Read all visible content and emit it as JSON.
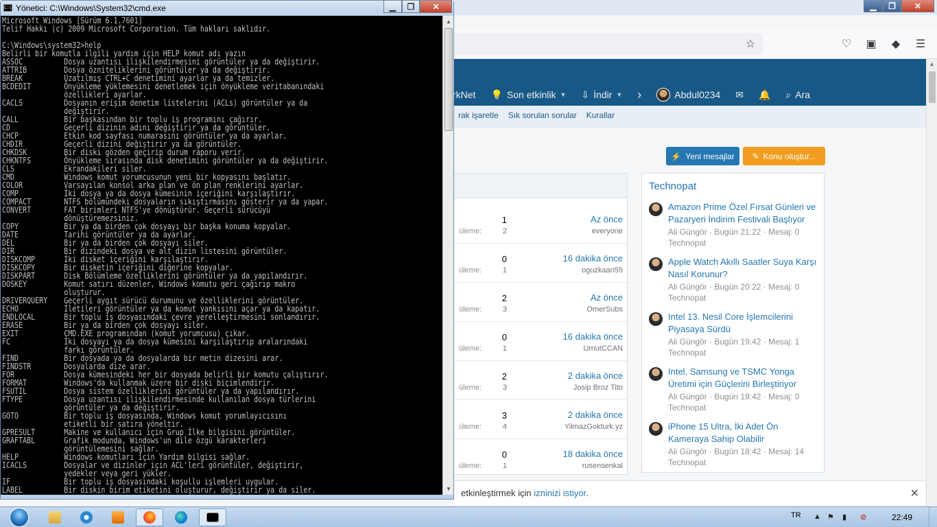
{
  "cmd": {
    "title": "Yönetici: C:\\Windows\\System32\\cmd.exe",
    "lines": [
      "Microsoft Windows [Sürüm 6.1.7601]",
      "Telif Hakkı (c) 2009 Microsoft Corporation. Tüm hakları saklıdır.",
      "",
      "C:\\Windows\\system32>help",
      "Belirli bir komutla ilgili yardım için HELP komut adı yazın",
      "ASSOC          Dosya uzantısı ilişkilendirmesini görüntüler ya da değiştirir.",
      "ATTRIB         Dosya özniteliklerini görüntüler ya da değiştirir.",
      "BREAK          Uzatılmış CTRL+C denetimini ayarlar ya da temizler.",
      "BCDEDIT        Önyükleme yüklemesini denetlemek için önyükleme veritabanındaki",
      "               özellikleri ayarlar.",
      "CACLS          Dosyanın erişim denetim listelerini (ACLs) görüntüler ya da",
      "               değiştirir.",
      "CALL           Bir başkasından bir toplu iş programını çağırır.",
      "CD             Geçerli dizinin adını değiştirir ya da görüntüler.",
      "CHCP           Etkin kod sayfası numarasını görüntüler ya da ayarlar.",
      "CHDIR          Geçerli dizini değiştirir ya da görüntüler.",
      "CHKDSK         Bir diski gözden geçirip durum raporu verir.",
      "CHKNTFS        Önyükleme sırasında disk denetimini görüntüler ya da değiştirir.",
      "CLS            Ekrandakileri siler.",
      "CMD            Windows komut yorumcusunun yeni bir kopyasını başlatır.",
      "COLOR          Varsayılan konsol arka plan ve ön plan renklerini ayarlar.",
      "COMP           İki dosya ya da dosya kümesinin içeriğini karşılaştırır.",
      "COMPACT        NTFS bölümündeki dosyaların sıkıştırmasını gösterir ya da yapar.",
      "CONVERT        FAT birimleri NTFS'ye dönüştürür. Geçerli sürücüyü",
      "               dönüştüremezsiniz.",
      "COPY           Bir ya da birden çok dosyayı bir başka konuma kopyalar.",
      "DATE           Tarihi görüntüler ya da ayarlar.",
      "DEL            Bir ya da birden çok dosyayı siler.",
      "DIR            Bir dizindeki dosya ve alt dizin listesini görüntüler.",
      "DISKCOMP       İki disket içeriğini karşılaştırır.",
      "DISKCOPY       Bir disketin içeriğini diğerine kopyalar.",
      "DISKPART       Disk Bölümleme özelliklerini görüntüler ya da yapılandırır.",
      "DOSKEY         Komut satırı düzenler, Windows komutu geri çağırıp makro",
      "               oluşturur.",
      "DRIVERQUERY    Geçerli aygıt sürücü durumunu ve özelliklerini görüntüler.",
      "ECHO           İletileri görüntüler ya da komut yankısını açar ya da kapatır.",
      "ENDLOCAL       Bir toplu iş dosyasındaki çevre yerelleştirmesini sonlandırır.",
      "ERASE          Bir ya da birden çok dosyayı siler.",
      "EXIT           CMD.EXE programından (komut yorumcusu) çıkar.",
      "FC             İki dosyayı ya da dosya kümesini karşılaştırıp aralarındaki",
      "               farkı görüntüler.",
      "FIND           Bir dosyada ya da dosyalarda bir metin dizesini arar.",
      "FINDSTR        Dosyalarda dize arar.",
      "FOR            Dosya kümesindeki her bir dosyada belirli bir komutu çalıştırır.",
      "FORMAT         Windows'da kullanmak üzere bir diski biçimlendirir.",
      "FSUTIL         Dosya sistem özelliklerini görüntüler ya da yapılandırır.",
      "FTYPE          Dosya uzantısı ilişkilendirmesinde kullanılan dosya türlerini",
      "               görüntüler ya da değiştirir.",
      "GOTO           Bir toplu iş dosyasında, Windows komut yorumlayıcısını",
      "               etiketli bir satıra yöneltir.",
      "GPRESULT       Makine ve kullanıcı için Grup İlke bilgisini görüntüler.",
      "GRAFTABL       Grafik modunda, Windows'un dile özgü karakterleri",
      "               görüntülemesini sağlar.",
      "HELP           Windows komutları için Yardım bilgisi sağlar.",
      "ICACLS         Dosyalar ve dizinler için ACL'leri görüntüler, değiştirir,",
      "               yedekler veya geri yükler.",
      "IF             Bir toplu iş dosyasındaki koşullu işlemleri uygular.",
      "LABEL          Bir diskin birim etiketini oluşturur, değiştirir ya da siler."
    ]
  },
  "browser": {
    "nav": {
      "item_technet_partial": "rkNet",
      "item_recent": "Son etkinlik",
      "item_download": "İndir",
      "username": "Abdul0234",
      "search": "Ara"
    },
    "subnav": [
      "rak işaretle",
      "Sık sorulan sorular",
      "Kurallar"
    ],
    "buttons": {
      "new_messages": "Yeni mesajlar",
      "new_topic": "Konu oluştur..."
    },
    "forum_rows": [
      {
        "label": "üleme:",
        "n1": "1",
        "n2": "2",
        "time": "Az önce",
        "user": "everyone"
      },
      {
        "label": "üleme:",
        "n1": "0",
        "n2": "1",
        "time": "16 dakika önce",
        "user": "oguzkaan55"
      },
      {
        "label": "üleme:",
        "n1": "2",
        "n2": "3",
        "time": "Az önce",
        "user": "OmerSubs"
      },
      {
        "label": "üleme:",
        "n1": "0",
        "n2": "1",
        "time": "16 dakika önce",
        "user": "UmutCCAN"
      },
      {
        "label": "üleme:",
        "n1": "2",
        "n2": "3",
        "time": "2 dakika önce",
        "user": "Josip Broz Tito"
      },
      {
        "label": "üleme:",
        "n1": "3",
        "n2": "4",
        "time": "2 dakika önce",
        "user": "YilmazGokturk.yz"
      },
      {
        "label": "üleme:",
        "n1": "0",
        "n2": "1",
        "time": "18 dakika önce",
        "user": "rusensenkal"
      }
    ],
    "technopat": {
      "title": "Technopat",
      "items": [
        {
          "title": "Amazon Prime Özel Fırsat Günleri ve Pazaryeri İndirim Festivali Başlıyor",
          "meta": "Ali Güngör · Bugün 21:22 · Mesaj: 0",
          "category": "Technopat"
        },
        {
          "title": "Apple Watch Akıllı Saatler Suya Karşı Nasıl Korunur?",
          "meta": "Ali Güngör · Bugün 20:22 · Mesaj: 0",
          "category": "Technopat"
        },
        {
          "title": "Intel 13. Nesil Core İşlemcilerini Piyasaya Sürdü",
          "meta": "Ali Güngör · Bugün 19:42 · Mesaj: 1",
          "category": "Technopat"
        },
        {
          "title": "Intel, Samsung ve TSMC Yonga Üretimi için Güçlerini Birleştiriyor",
          "meta": "Ali Güngör · Bugün 19:42 · Mesaj: 0",
          "category": "Technopat"
        },
        {
          "title": "iPhone 15 Ultra, İki Adet Ön Kameraya Sahip Olabilir",
          "meta": "Ali Güngör · Bugün 18:42 · Mesaj: 14",
          "category": "Technopat"
        }
      ]
    },
    "notice": {
      "prefix": "etkinleştirmek için",
      "link": "izninizi istiyor",
      "suffix": "."
    }
  },
  "taskbar": {
    "lang": "TR",
    "clock": "22:49"
  },
  "colors": {
    "nav_blue": "#185886",
    "accent_orange": "#f29d1f",
    "link_blue": "#2577b1"
  }
}
